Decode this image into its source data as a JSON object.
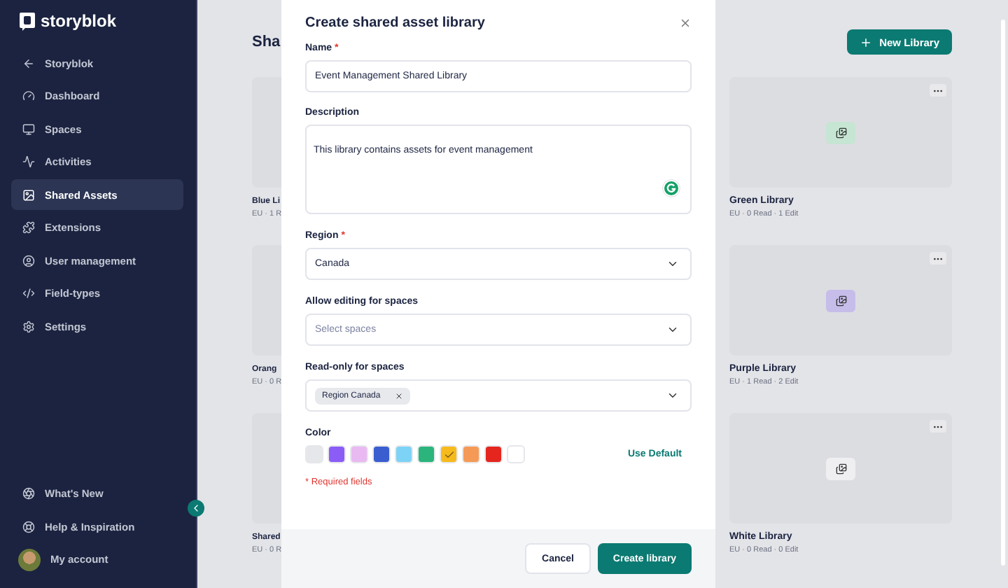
{
  "sidebar": {
    "brand": "storyblok",
    "items": [
      {
        "label": "Storyblok",
        "selected": false
      },
      {
        "label": "Dashboard",
        "selected": false
      },
      {
        "label": "Spaces",
        "selected": false
      },
      {
        "label": "Activities",
        "selected": false
      },
      {
        "label": "Shared Assets",
        "selected": true
      },
      {
        "label": "Extensions",
        "selected": false
      },
      {
        "label": "User management",
        "selected": false
      },
      {
        "label": "Field-types",
        "selected": false
      },
      {
        "label": "Settings",
        "selected": false
      }
    ],
    "bottom_items": [
      {
        "label": "What's New",
        "selected": false
      },
      {
        "label": "Help & Inspiration",
        "selected": false
      }
    ],
    "account": "My account"
  },
  "page": {
    "title": "Sha",
    "new_button": "New Library",
    "left_cards": [
      {
        "name": "Blue Li",
        "meta": "EU · 1 R"
      },
      {
        "name": "Orang",
        "meta": "EU · 0 R"
      },
      {
        "name": "Shared",
        "meta": "EU · 0 R"
      }
    ],
    "right_cards": [
      {
        "name": "Green Library",
        "meta": "EU · 0 Read · 1 Edit",
        "color": "#c6e5d3"
      },
      {
        "name": "Purple Library",
        "meta": "EU · 1 Read · 2 Edit",
        "color": "#c7bdea"
      },
      {
        "name": "White Library",
        "meta": "EU · 0 Read · 0 Edit",
        "color": "#efeff2"
      }
    ]
  },
  "modal": {
    "title": "Create shared asset library",
    "name": {
      "label": "Name",
      "required_mark": "*",
      "value": "Event Management Shared Library"
    },
    "description": {
      "label": "Description",
      "value": "This library contains assets for event management"
    },
    "region": {
      "label": "Region",
      "required_mark": "*",
      "value": "Canada"
    },
    "editing": {
      "label": "Allow editing for spaces",
      "placeholder": "Select spaces"
    },
    "readonly": {
      "label": "Read-only for spaces",
      "tags": [
        "Region Canada"
      ]
    },
    "color": {
      "label": "Color",
      "default_button": "Use Default",
      "swatches": [
        {
          "color": "#e5e7eb",
          "selected": false
        },
        {
          "color": "#8b5cf6",
          "selected": false
        },
        {
          "color": "#e9b9f1",
          "selected": false
        },
        {
          "color": "#3a5ed0",
          "selected": false
        },
        {
          "color": "#7dd3f6",
          "selected": false
        },
        {
          "color": "#2bb47c",
          "selected": false
        },
        {
          "color": "#f6ba1d",
          "selected": true
        },
        {
          "color": "#f59a56",
          "selected": false
        },
        {
          "color": "#e4261f",
          "selected": false
        },
        {
          "color": "#ffffff",
          "selected": false
        }
      ]
    },
    "required_note": "* Required fields",
    "cancel": "Cancel",
    "submit": "Create library"
  }
}
